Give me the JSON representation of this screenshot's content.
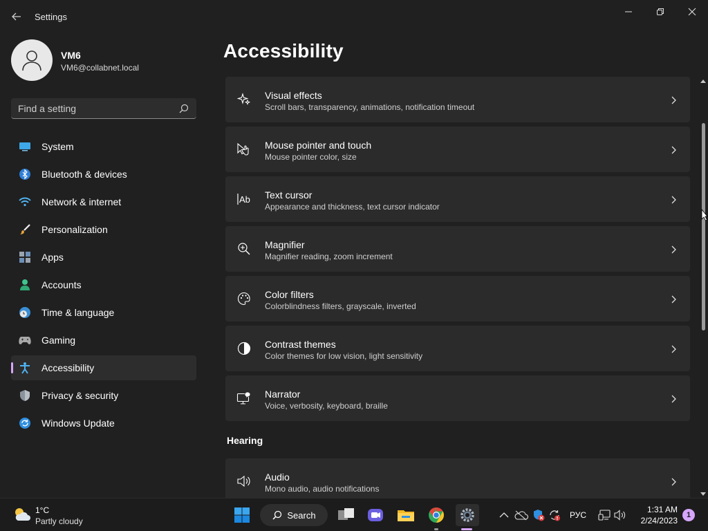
{
  "window": {
    "app_title": "Settings"
  },
  "profile": {
    "name": "VM6",
    "email": "VM6@collabnet.local"
  },
  "search": {
    "placeholder": "Find a setting"
  },
  "sidebar": {
    "items": [
      {
        "label": "System",
        "icon": "system-icon",
        "active": false
      },
      {
        "label": "Bluetooth & devices",
        "icon": "bluetooth-icon",
        "active": false
      },
      {
        "label": "Network & internet",
        "icon": "wifi-icon",
        "active": false
      },
      {
        "label": "Personalization",
        "icon": "brush-icon",
        "active": false
      },
      {
        "label": "Apps",
        "icon": "apps-icon",
        "active": false
      },
      {
        "label": "Accounts",
        "icon": "accounts-icon",
        "active": false
      },
      {
        "label": "Time & language",
        "icon": "clock-globe-icon",
        "active": false
      },
      {
        "label": "Gaming",
        "icon": "gamepad-icon",
        "active": false
      },
      {
        "label": "Accessibility",
        "icon": "accessibility-icon",
        "active": true
      },
      {
        "label": "Privacy & security",
        "icon": "shield-icon",
        "active": false
      },
      {
        "label": "Windows Update",
        "icon": "update-icon",
        "active": false
      }
    ]
  },
  "main": {
    "title": "Accessibility",
    "cards": [
      {
        "title": "Visual effects",
        "subtitle": "Scroll bars, transparency, animations, notification timeout",
        "icon": "sparkle-icon"
      },
      {
        "title": "Mouse pointer and touch",
        "subtitle": "Mouse pointer color, size",
        "icon": "pointer-touch-icon"
      },
      {
        "title": "Text cursor",
        "subtitle": "Appearance and thickness, text cursor indicator",
        "icon": "text-cursor-icon"
      },
      {
        "title": "Magnifier",
        "subtitle": "Magnifier reading, zoom increment",
        "icon": "magnifier-icon"
      },
      {
        "title": "Color filters",
        "subtitle": "Colorblindness filters, grayscale, inverted",
        "icon": "palette-icon"
      },
      {
        "title": "Contrast themes",
        "subtitle": "Color themes for low vision, light sensitivity",
        "icon": "contrast-icon"
      },
      {
        "title": "Narrator",
        "subtitle": "Voice, verbosity, keyboard, braille",
        "icon": "narrator-icon"
      }
    ],
    "section_hearing": "Hearing",
    "audio": {
      "title": "Audio",
      "subtitle": "Mono audio, audio notifications",
      "icon": "speaker-icon"
    }
  },
  "taskbar": {
    "weather_temp": "1°C",
    "weather_desc": "Partly cloudy",
    "search_label": "Search",
    "language": "РУС",
    "time": "1:31 AM",
    "date": "2/24/2023",
    "notification_count": "1"
  },
  "colors": {
    "background": "#202020",
    "card": "#2b2b2b",
    "accent": "#d6a6ff"
  }
}
